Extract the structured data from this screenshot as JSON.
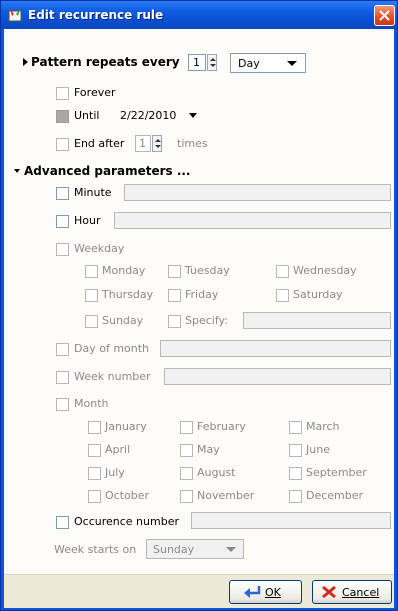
{
  "window": {
    "title": "Edit recurrence rule"
  },
  "pattern": {
    "label": "Pattern repeats every",
    "value": "1",
    "unit": "Day"
  },
  "end_options": {
    "forever": "Forever",
    "until": "Until",
    "until_date": "2/22/2010",
    "end_after": "End after",
    "end_after_value": "1",
    "times": "times"
  },
  "advanced": {
    "label": "Advanced parameters ...",
    "minute": "Minute",
    "hour": "Hour",
    "weekday": "Weekday",
    "weekdays": [
      "Monday",
      "Tuesday",
      "Wednesday",
      "Thursday",
      "Friday",
      "Saturday",
      "Sunday",
      "Specify:"
    ],
    "day_of_month": "Day of month",
    "week_number": "Week number",
    "month": "Month",
    "months": [
      "January",
      "February",
      "March",
      "April",
      "May",
      "June",
      "July",
      "August",
      "September",
      "October",
      "November",
      "December"
    ],
    "occurence_number": "Occurence number",
    "week_starts_label": "Week starts on",
    "week_starts_value": "Sunday"
  },
  "buttons": {
    "ok": "OK",
    "cancel": "Cancel"
  },
  "colors": {
    "title_bar": "#0a56d8",
    "close_button": "#e24d25",
    "window_bg": "#fdfcf8",
    "footer_bg": "#ece9d8"
  }
}
